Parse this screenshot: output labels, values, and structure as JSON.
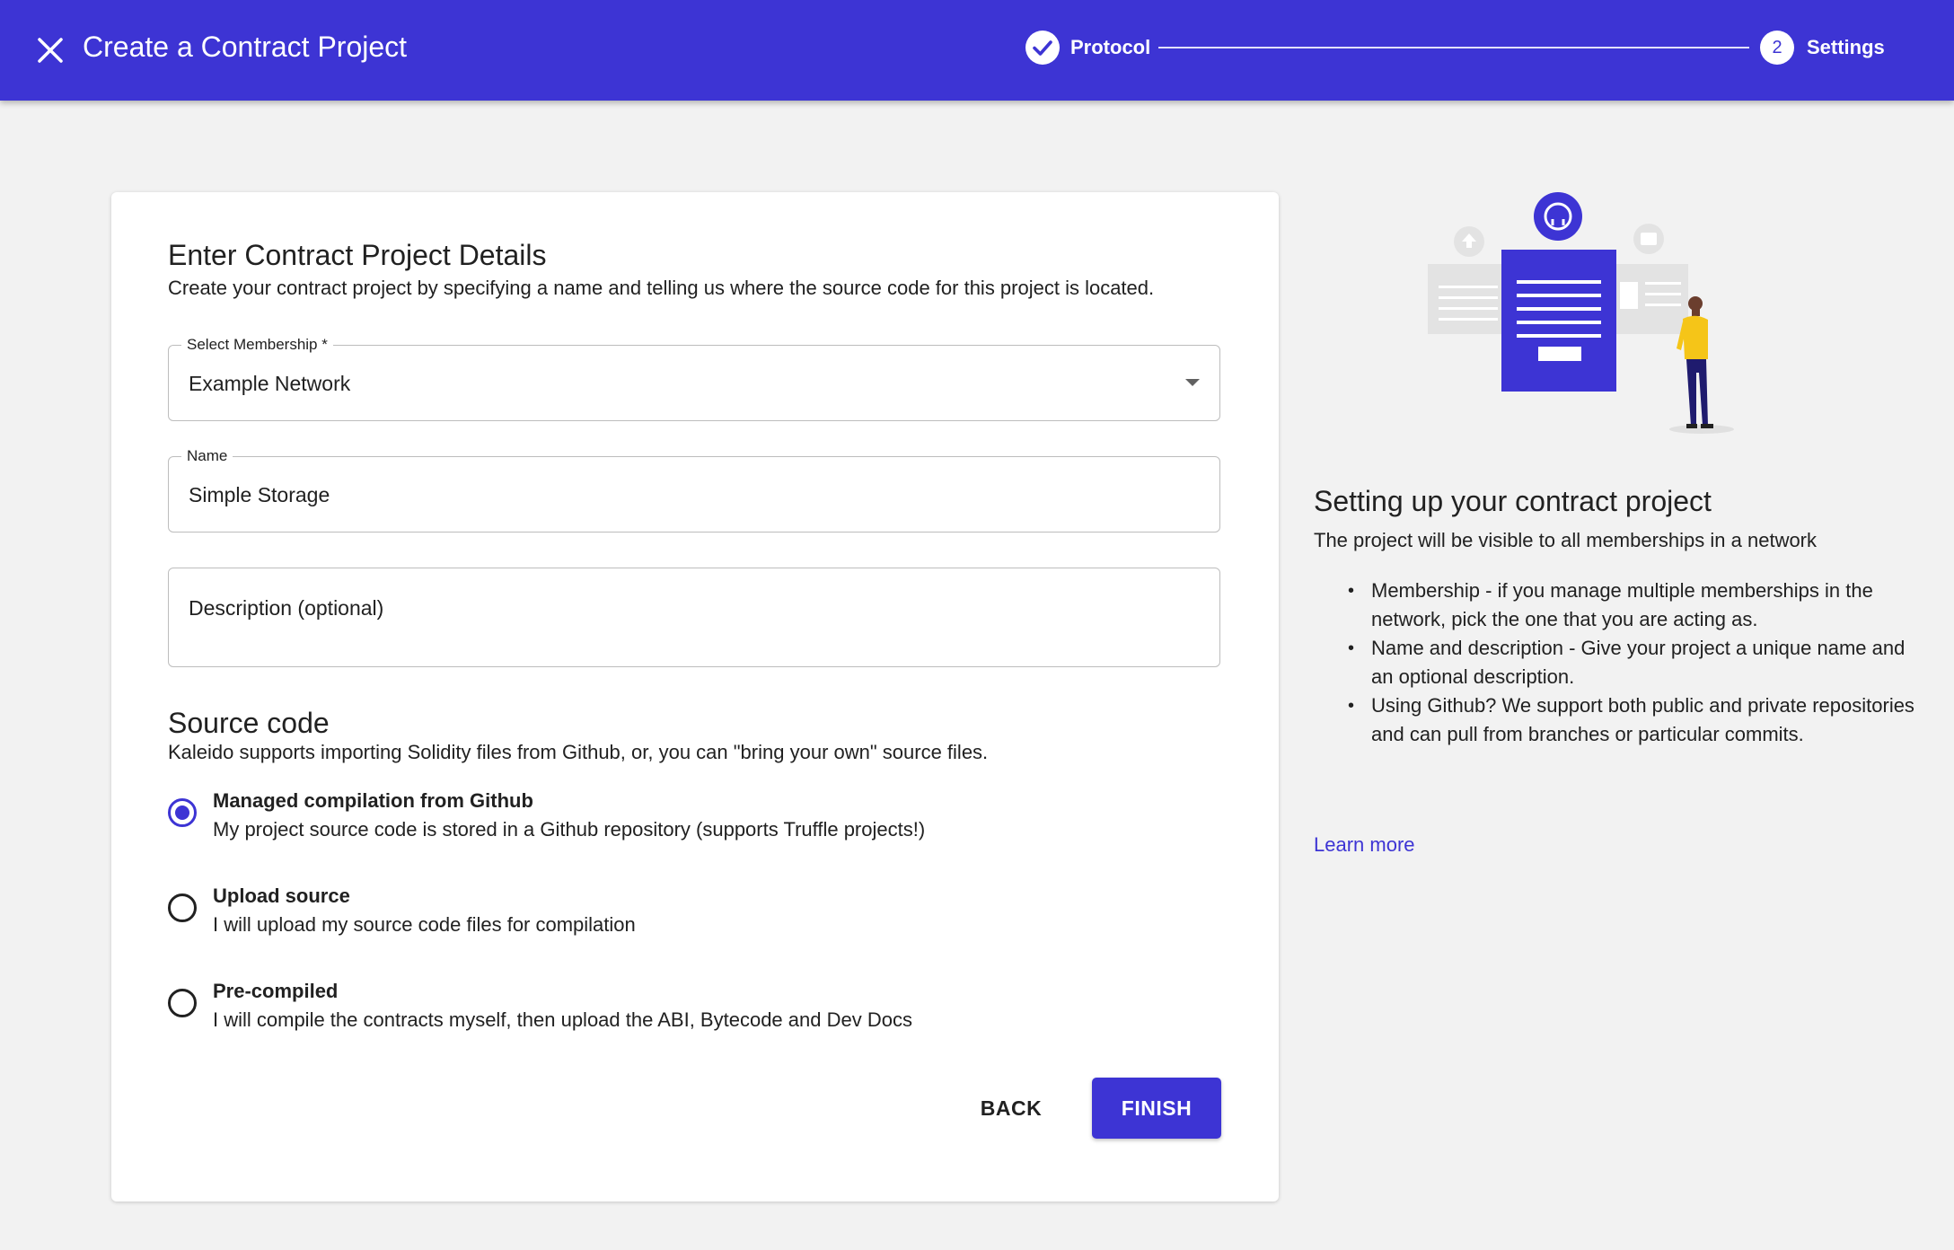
{
  "colors": {
    "primary": "#3d34d4",
    "background": "#f2f2f2",
    "accent_person_shirt": "#f5c518"
  },
  "header": {
    "title": "Create a Contract Project",
    "close_icon": "close-icon",
    "stepper": [
      {
        "label": "Protocol",
        "state": "completed",
        "icon": "check-icon"
      },
      {
        "label": "Settings",
        "state": "active",
        "number": "2"
      }
    ]
  },
  "form": {
    "title": "Enter Contract Project Details",
    "subtitle": "Create your contract project by specifying a name and telling us where the source code for this project is located.",
    "membership": {
      "label": "Select Membership *",
      "value": "Example Network"
    },
    "name": {
      "label": "Name",
      "value": "Simple Storage"
    },
    "description": {
      "placeholder": "Description (optional)"
    }
  },
  "source_code": {
    "title": "Source code",
    "subtitle": "Kaleido supports importing Solidity files from Github, or, you can \"bring your own\" source files.",
    "options": [
      {
        "title": "Managed compilation from Github",
        "description": "My project source code is stored in a Github repository (supports Truffle projects!)",
        "selected": true
      },
      {
        "title": "Upload source",
        "description": "I will upload my source code files for compilation",
        "selected": false
      },
      {
        "title": "Pre-compiled",
        "description": "I will compile the contracts myself, then upload the ABI, Bytecode and Dev Docs",
        "selected": false
      }
    ]
  },
  "actions": {
    "back": "BACK",
    "finish": "FINISH"
  },
  "info": {
    "title": "Setting up your contract project",
    "subtitle": "The project will be visible to all memberships in a network",
    "bullets": [
      "Membership - if you manage multiple memberships in the network, pick the one that you are acting as.",
      "Name and description - Give your project a unique name and an optional description.",
      "Using Github? We support both public and private repositories and can pull from branches or particular commits."
    ],
    "learn_more": "Learn more"
  }
}
